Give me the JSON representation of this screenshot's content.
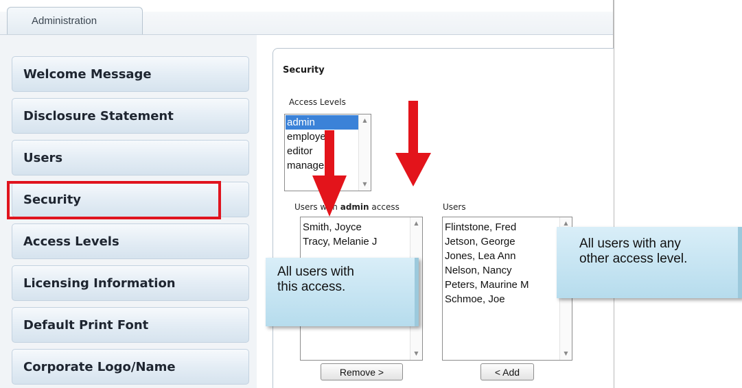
{
  "tabs": {
    "active": "Administration"
  },
  "sidebar": {
    "items": [
      {
        "label": "Welcome Message"
      },
      {
        "label": "Disclosure Statement"
      },
      {
        "label": "Users"
      },
      {
        "label": "Security"
      },
      {
        "label": "Access Levels"
      },
      {
        "label": "Licensing Information"
      },
      {
        "label": "Default Print Font"
      },
      {
        "label": "Corporate Logo/Name"
      }
    ],
    "selected": "Security"
  },
  "security": {
    "title": "Security",
    "access_levels_label": "Access Levels",
    "access_levels": [
      "admin",
      "employee",
      "editor",
      "managers"
    ],
    "selected_level": "admin",
    "users_with_prefix": "Users with",
    "users_with_level": "admin",
    "users_with_suffix": "access",
    "users_label": "Users",
    "users_with_access": [
      "Smith, Joyce",
      "Tracy, Melanie J"
    ],
    "other_users": [
      "Flintstone, Fred",
      "Jetson, George",
      "Jones, Lea Ann",
      "Nelson, Nancy",
      "Peters, Maurine M",
      "Schmoe, Joe"
    ],
    "remove_button": "Remove >",
    "add_button": "< Add"
  },
  "callouts": {
    "left_line1": "All users with",
    "left_line2": "this access.",
    "right_line1": "All users with any",
    "right_line2": "other access level."
  },
  "colors": {
    "highlight": "#e0141e",
    "arrow": "#e3141b",
    "selection": "#3b82d8"
  }
}
